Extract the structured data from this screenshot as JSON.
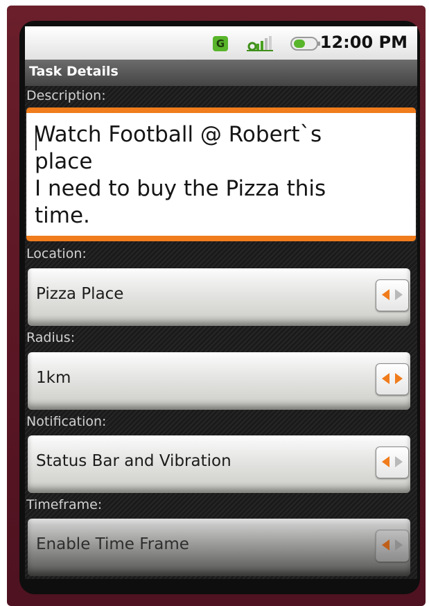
{
  "status_bar": {
    "network_label": "G",
    "time": "12:00 PM",
    "icons": [
      "network-type-icon",
      "signal-strength-icon",
      "battery-icon"
    ]
  },
  "title_bar": {
    "title": "Task Details"
  },
  "form": {
    "description": {
      "label": "Description:",
      "value": "Watch Football @ Robert`s\nplace\nI need to buy the Pizza this\ntime."
    },
    "location": {
      "label": "Location:",
      "value": "Pizza Place",
      "enabled": true
    },
    "radius": {
      "label": "Radius:",
      "value": "1km",
      "enabled": true
    },
    "notification": {
      "label": "Notification:",
      "value": "Status Bar and Vibration",
      "enabled": true
    },
    "timeframe": {
      "label": "Timeframe:",
      "value": "Enable Time Frame",
      "enabled": false
    }
  },
  "colors": {
    "accent": "#f07c1c",
    "device_body": "#5a1624",
    "signal_green": "#59b52b"
  }
}
